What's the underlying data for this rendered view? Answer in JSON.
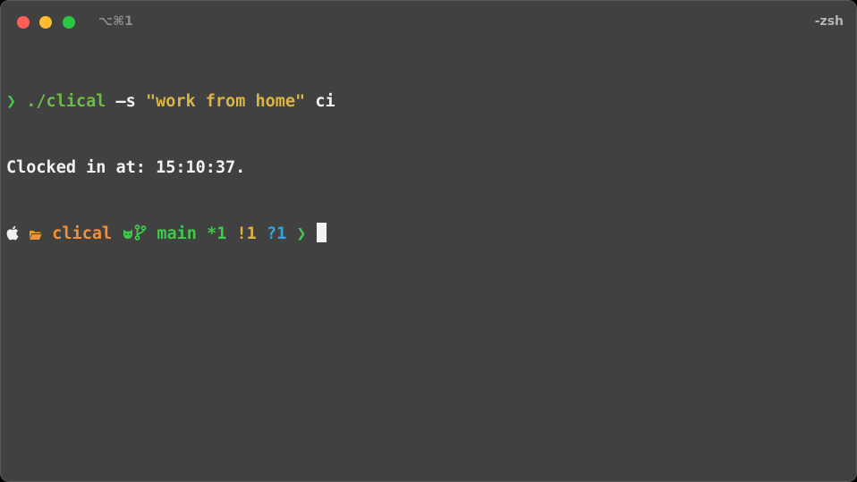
{
  "window": {
    "shortcut_label": "⌥⌘1",
    "tab_title": "-zsh"
  },
  "terminal": {
    "line1": {
      "prompt_symbol": "❯",
      "command": "./clical",
      "flag": "–s",
      "argument": "\"work from home\"",
      "subcommand": "ci"
    },
    "line2": {
      "output": "Clocked in at: 15:10:37."
    },
    "line3": {
      "directory": "clical",
      "branch": "main",
      "staged": "*1",
      "modified": "!1",
      "untracked": "?1",
      "prompt_symbol": "❯"
    }
  },
  "colors": {
    "background": "#414141",
    "prompt_green": "#3fc94a",
    "string_yellow": "#d9b446",
    "directory_orange": "#f0903a",
    "untracked_cyan": "#2ea7e0"
  },
  "icons": [
    "apple-icon",
    "folder-icon",
    "github-cat-icon",
    "git-branch-icon"
  ]
}
